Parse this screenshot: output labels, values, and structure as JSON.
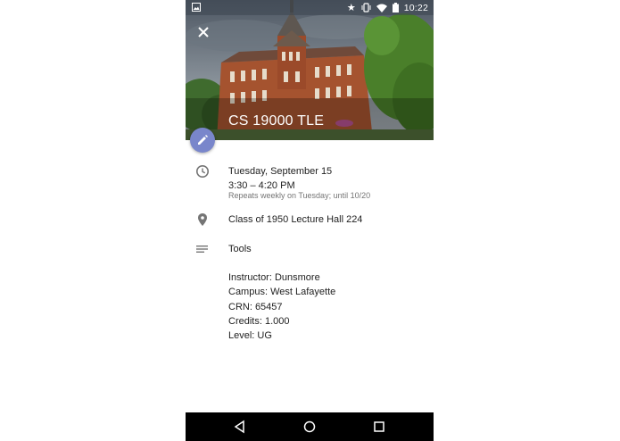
{
  "status_bar": {
    "time": "10:22",
    "icons": [
      "image-icon",
      "star-icon",
      "vibrate-icon",
      "wifi-icon",
      "battery-icon"
    ]
  },
  "header": {
    "title": "CS 19000 TLE",
    "close_icon": "close-icon",
    "edit_icon": "pencil-icon",
    "edit_color": "#7986cb"
  },
  "details": {
    "date": "Tuesday, September 15",
    "time_range": "3:30 – 4:20 PM",
    "repeat": "Repeats weekly on Tuesday; until 10/20",
    "location": "Class of 1950 Lecture Hall 224",
    "description_title": "Tools",
    "info": [
      "Instructor: Dunsmore",
      "Campus: West Lafayette",
      "CRN: 65457",
      "Credits: 1.000",
      "Level: UG"
    ]
  },
  "nav_bar": {
    "icons": [
      "back-icon",
      "home-icon",
      "recents-icon"
    ]
  }
}
